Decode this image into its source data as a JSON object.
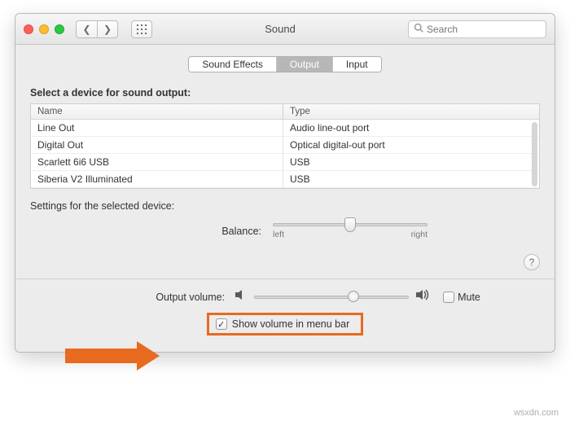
{
  "window": {
    "title": "Sound"
  },
  "search": {
    "placeholder": "Search"
  },
  "tabs": {
    "effects": "Sound Effects",
    "output": "Output",
    "input": "Input"
  },
  "section_label": "Select a device for sound output:",
  "columns": {
    "name": "Name",
    "type": "Type"
  },
  "devices": [
    {
      "name": "Line Out",
      "type": "Audio line-out port"
    },
    {
      "name": "Digital Out",
      "type": "Optical digital-out port"
    },
    {
      "name": "Scarlett 6i6 USB",
      "type": "USB"
    },
    {
      "name": "Siberia V2 Illuminated",
      "type": "USB"
    }
  ],
  "settings_label": "Settings for the selected device:",
  "balance": {
    "label": "Balance:",
    "left": "left",
    "right": "right",
    "value": 0.5
  },
  "output_volume": {
    "label": "Output volume:",
    "value": 0.64
  },
  "mute": {
    "label": "Mute",
    "checked": false
  },
  "show_in_menubar": {
    "label": "Show volume in menu bar",
    "checked": true
  },
  "watermark": "wsxdn.com"
}
